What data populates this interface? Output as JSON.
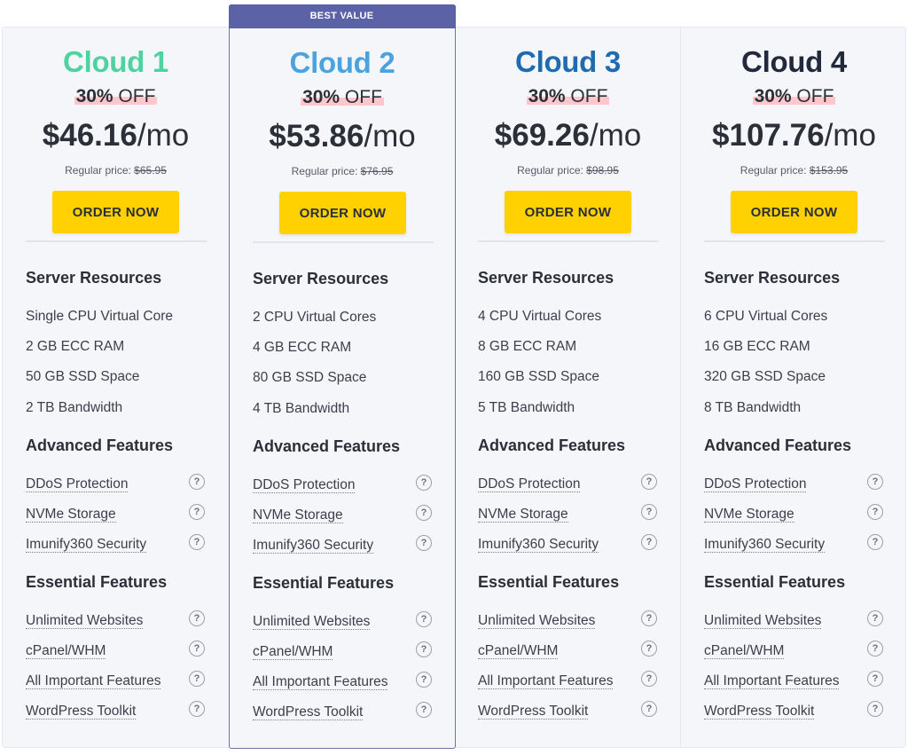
{
  "best_value_label": "BEST VALUE",
  "plans": [
    {
      "name": "Cloud 1",
      "name_color": "#4fd1a0",
      "discount_pct": "30%",
      "discount_off": " OFF",
      "price": "$46.16",
      "per": "/mo",
      "regular_label": "Regular price: ",
      "regular_price": "$65.95",
      "order_label": "ORDER NOW",
      "server_title": "Server Resources",
      "server": [
        "Single CPU Virtual Core",
        "2 GB ECC RAM",
        "50 GB SSD Space",
        "2 TB Bandwidth"
      ],
      "advanced_title": "Advanced Features",
      "advanced": [
        "DDoS Protection",
        "NVMe Storage",
        "Imunify360 Security"
      ],
      "essential_title": "Essential Features",
      "essential": [
        "Unlimited Websites",
        "cPanel/WHM",
        "All Important Features",
        "WordPress Toolkit"
      ]
    },
    {
      "name": "Cloud 2",
      "name_color": "#4aa3df",
      "discount_pct": "30%",
      "discount_off": " OFF",
      "price": "$53.86",
      "per": "/mo",
      "regular_label": "Regular price: ",
      "regular_price": "$76.95",
      "order_label": "ORDER NOW",
      "server_title": "Server Resources",
      "server": [
        "2 CPU Virtual Cores",
        "4 GB ECC RAM",
        "80 GB SSD Space",
        "4 TB Bandwidth"
      ],
      "advanced_title": "Advanced Features",
      "advanced": [
        "DDoS Protection",
        "NVMe Storage",
        "Imunify360 Security"
      ],
      "essential_title": "Essential Features",
      "essential": [
        "Unlimited Websites",
        "cPanel/WHM",
        "All Important Features",
        "WordPress Toolkit"
      ]
    },
    {
      "name": "Cloud 3",
      "name_color": "#1f6bb0",
      "discount_pct": "30%",
      "discount_off": " OFF",
      "price": "$69.26",
      "per": "/mo",
      "regular_label": "Regular price: ",
      "regular_price": "$98.95",
      "order_label": "ORDER NOW",
      "server_title": "Server Resources",
      "server": [
        "4 CPU Virtual Cores",
        "8 GB ECC RAM",
        "160 GB SSD Space",
        "5 TB Bandwidth"
      ],
      "advanced_title": "Advanced Features",
      "advanced": [
        "DDoS Protection",
        "NVMe Storage",
        "Imunify360 Security"
      ],
      "essential_title": "Essential Features",
      "essential": [
        "Unlimited Websites",
        "cPanel/WHM",
        "All Important Features",
        "WordPress Toolkit"
      ]
    },
    {
      "name": "Cloud 4",
      "name_color": "#23293d",
      "discount_pct": "30%",
      "discount_off": " OFF",
      "price": "$107.76",
      "per": "/mo",
      "regular_label": "Regular price: ",
      "regular_price": "$153.95",
      "order_label": "ORDER NOW",
      "server_title": "Server Resources",
      "server": [
        "6 CPU Virtual Cores",
        "16 GB ECC RAM",
        "320 GB SSD Space",
        "8 TB Bandwidth"
      ],
      "advanced_title": "Advanced Features",
      "advanced": [
        "DDoS Protection",
        "NVMe Storage",
        "Imunify360 Security"
      ],
      "essential_title": "Essential Features",
      "essential": [
        "Unlimited Websites",
        "cPanel/WHM",
        "All Important Features",
        "WordPress Toolkit"
      ]
    }
  ],
  "help_icon_glyph": "?",
  "colors": {
    "button": "#ffd100",
    "featured_border": "#6b72ad",
    "badge": "#5b62a5",
    "highlight": "#ffc6cc"
  }
}
